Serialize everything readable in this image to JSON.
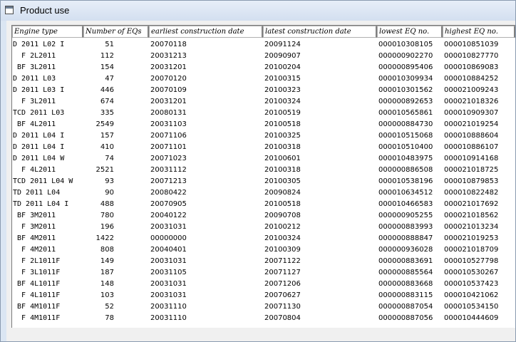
{
  "window": {
    "title": "Product use"
  },
  "columns": [
    "Engine type",
    "Number of EQs",
    "earliest construction date",
    "latest construction date",
    "lowest EQ no.",
    "highest EQ no."
  ],
  "rows": [
    [
      "D 2011 L02 I",
      "51",
      "20070118",
      "20091124",
      "000010308105",
      "000010851039"
    ],
    [
      "  F 2L2011",
      "112",
      "20031213",
      "20090907",
      "000000902270",
      "000010827770"
    ],
    [
      " BF 3L2011",
      "154",
      "20031201",
      "20100204",
      "000000895406",
      "000010869083"
    ],
    [
      "D 2011 L03",
      "47",
      "20070120",
      "20100315",
      "000010309934",
      "000010884252"
    ],
    [
      "D 2011 L03 I",
      "446",
      "20070109",
      "20100323",
      "000010301562",
      "000021009243"
    ],
    [
      "  F 3L2011",
      "674",
      "20031201",
      "20100324",
      "000000892653",
      "000021018326"
    ],
    [
      "TCD 2011 L03",
      "335",
      "20080131",
      "20100519",
      "000010565861",
      "000010909307"
    ],
    [
      " BF 4L2011",
      "2549",
      "20031103",
      "20100518",
      "000000884730",
      "000021019254"
    ],
    [
      "D 2011 L04 I",
      "157",
      "20071106",
      "20100325",
      "000010515068",
      "000010888604"
    ],
    [
      "D 2011 L04 I",
      "410",
      "20071101",
      "20100318",
      "000010510400",
      "000010886107"
    ],
    [
      "D 2011 L04 W",
      "74",
      "20071023",
      "20100601",
      "000010483975",
      "000010914168"
    ],
    [
      "  F 4L2011",
      "2521",
      "20031112",
      "20100318",
      "000000886508",
      "000021018725"
    ],
    [
      "TCD 2011 L04 W",
      "93",
      "20071213",
      "20100305",
      "000010538196",
      "000010879853"
    ],
    [
      "TD 2011 L04",
      "90",
      "20080422",
      "20090824",
      "000010634512",
      "000010822482"
    ],
    [
      "TD 2011 L04 I",
      "488",
      "20070905",
      "20100518",
      "000010466583",
      "000021017692"
    ],
    [
      " BF 3M2011",
      "780",
      "20040122",
      "20090708",
      "000000905255",
      "000021018562"
    ],
    [
      "  F 3M2011",
      "196",
      "20031031",
      "20100212",
      "000000883993",
      "000021013234"
    ],
    [
      " BF 4M2011",
      "1422",
      "00000000",
      "20100324",
      "000000888847",
      "000021019253"
    ],
    [
      "  F 4M2011",
      "808",
      "20040401",
      "20100309",
      "000000936028",
      "000021018709"
    ],
    [
      "  F 2L1011F",
      "149",
      "20031031",
      "20071122",
      "000000883691",
      "000010527798"
    ],
    [
      "  F 3L1011F",
      "187",
      "20031105",
      "20071127",
      "000000885564",
      "000010530267"
    ],
    [
      " BF 4L1011F",
      "148",
      "20031031",
      "20071206",
      "000000883668",
      "000010537423"
    ],
    [
      "  F 4L1011F",
      "103",
      "20031031",
      "20070627",
      "000000883115",
      "000010421062"
    ],
    [
      " BF 4M1011F",
      "52",
      "20031110",
      "20071130",
      "000000887054",
      "000010534150"
    ],
    [
      "  F 4M1011F",
      "78",
      "20031110",
      "20070804",
      "000000887056",
      "000010444609"
    ]
  ]
}
